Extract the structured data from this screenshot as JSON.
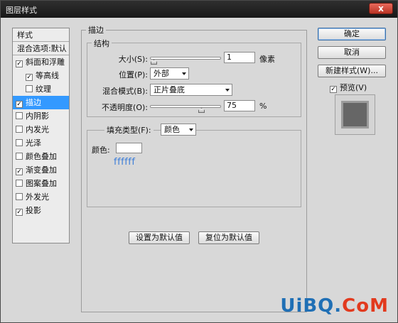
{
  "window": {
    "title": "图层样式",
    "close_glyph": "x"
  },
  "style_list": {
    "header": "样式",
    "blending": "混合选项:默认",
    "items": [
      {
        "label": "斜面和浮雕",
        "checked": true,
        "indent": "top",
        "selected": false
      },
      {
        "label": "等高线",
        "checked": true,
        "indent": "sub",
        "selected": false
      },
      {
        "label": "纹理",
        "checked": false,
        "indent": "sub",
        "selected": false
      },
      {
        "label": "描边",
        "checked": true,
        "indent": "top",
        "selected": true
      },
      {
        "label": "内阴影",
        "checked": false,
        "indent": "top",
        "selected": false
      },
      {
        "label": "内发光",
        "checked": false,
        "indent": "top",
        "selected": false
      },
      {
        "label": "光泽",
        "checked": false,
        "indent": "top",
        "selected": false
      },
      {
        "label": "颜色叠加",
        "checked": false,
        "indent": "top",
        "selected": false
      },
      {
        "label": "渐变叠加",
        "checked": true,
        "indent": "top",
        "selected": false
      },
      {
        "label": "图案叠加",
        "checked": false,
        "indent": "top",
        "selected": false
      },
      {
        "label": "外发光",
        "checked": false,
        "indent": "top",
        "selected": false
      },
      {
        "label": "投影",
        "checked": true,
        "indent": "top",
        "selected": false
      }
    ]
  },
  "stroke": {
    "section_title": "描边",
    "structure_title": "结构",
    "size_label": "大小(S):",
    "size_value": "1",
    "size_unit": "像素",
    "size_slider_fraction": 0.0,
    "position_label": "位置(P):",
    "position_value": "外部",
    "blend_label": "混合模式(B):",
    "blend_value": "正片叠底",
    "opacity_label": "不透明度(O):",
    "opacity_value": "75",
    "opacity_unit": "%",
    "opacity_slider_fraction": 0.75,
    "fill_type_label": "填充类型(F):",
    "fill_type_value": "颜色",
    "color_label": "颜色:",
    "color_hex_note": "ffffff",
    "color_swatch": "#ffffff",
    "btn_set_default": "设置为默认值",
    "btn_reset_default": "复位为默认值"
  },
  "actions": {
    "ok": "确定",
    "cancel": "取消",
    "new_style": "新建样式(W)...",
    "preview_label": "预览(V)",
    "preview_checked": true
  },
  "colors": {
    "selection": "#3399ff",
    "titlebar": "#1e1e1e",
    "hex_note": "#3c7dd8"
  },
  "watermark": {
    "part1": "UiBQ.",
    "part2": "CoM"
  }
}
